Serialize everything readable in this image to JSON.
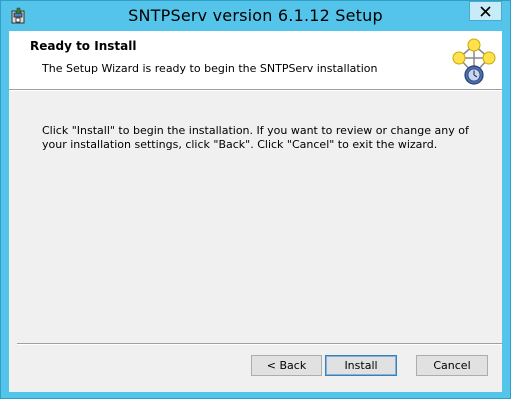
{
  "window": {
    "title": "SNTPServ version 6.1.12 Setup",
    "close_glyph": "✕",
    "icon": "installer-icon"
  },
  "header": {
    "title": "Ready to Install",
    "subtitle": "The Setup Wizard is ready to begin the SNTPServ installation",
    "logo_icon": "network-clock-icon"
  },
  "body": {
    "text": "Click \"Install\" to begin the installation.  If you want to review or change any of your installation settings, click \"Back\".  Click \"Cancel\" to exit the wizard."
  },
  "buttons": {
    "back": "< Back",
    "install": "Install",
    "cancel": "Cancel"
  },
  "colors": {
    "frame": "#55c4ea",
    "content_bg": "#f0f0f0",
    "header_bg": "#ffffff"
  }
}
